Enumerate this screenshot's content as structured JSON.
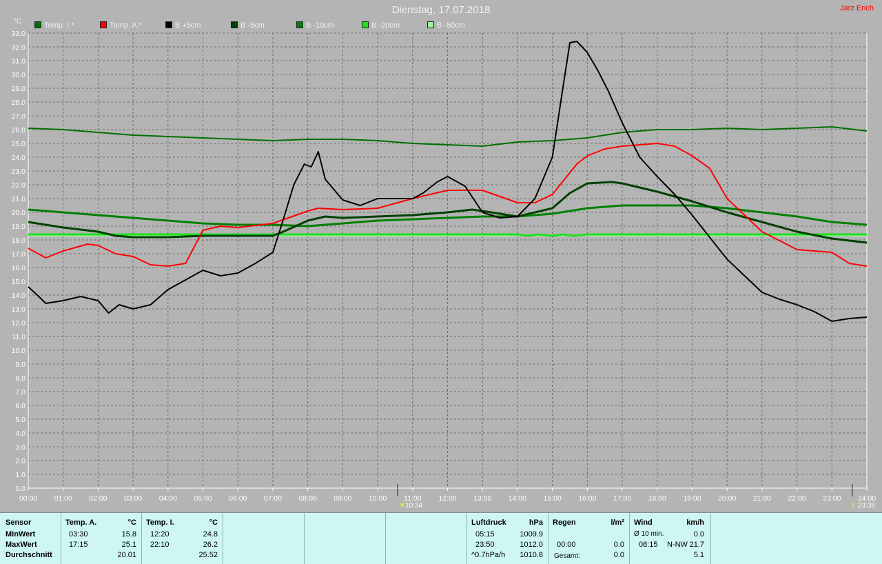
{
  "title": "Dienstag, 17.07.2018",
  "author": "Jarz Erich",
  "unit_label": "°C",
  "markers": {
    "left": {
      "time": "10:34",
      "hour": 10.567
    },
    "right": {
      "time": "23:35",
      "hour": 23.583
    }
  },
  "legend": [
    {
      "label": "Temp. I.*",
      "color": "#007000"
    },
    {
      "label": "Temp. A.*",
      "color": "#ff0000"
    },
    {
      "label": "B +5cm",
      "color": "#000000"
    },
    {
      "label": "B -5cm",
      "color": "#004000"
    },
    {
      "label": "B -10cm",
      "color": "#008000"
    },
    {
      "label": "B -20cm",
      "color": "#20e020"
    },
    {
      "label": "B -50cm",
      "color": "#a0f0a0"
    }
  ],
  "chart_data": {
    "type": "line",
    "title": "Dienstag, 17.07.2018",
    "ylabel": "°C",
    "ylim": [
      0,
      33
    ],
    "y_ticks": [
      "0.0",
      "1.0",
      "2.0",
      "3.0",
      "4.0",
      "5.0",
      "6.0",
      "7.0",
      "8.0",
      "9.0",
      "10.0",
      "11.0",
      "12.0",
      "13.0",
      "14.0",
      "15.0",
      "16.0",
      "17.0",
      "18.0",
      "19.0",
      "20.0",
      "21.0",
      "22.0",
      "23.0",
      "24.0",
      "25.0",
      "26.0",
      "27.0",
      "28.0",
      "29.0",
      "30.0",
      "31.0",
      "32.0",
      "33.0"
    ],
    "xlim": [
      0,
      24
    ],
    "x_ticks": [
      "00:00",
      "01:00",
      "02:00",
      "03:00",
      "04:00",
      "05:00",
      "06:00",
      "07:00",
      "08:00",
      "09:00",
      "10:00",
      "11:00",
      "12:00",
      "13:00",
      "14:00",
      "15:00",
      "16:00",
      "17:00",
      "18:00",
      "19:00",
      "20:00",
      "21:00",
      "22:00",
      "23:00",
      "24:00"
    ],
    "grid": true,
    "series": [
      {
        "name": "Temp. I.*",
        "color": "#007000",
        "width": 2,
        "x": [
          0,
          1,
          2,
          3,
          4,
          5,
          6,
          7,
          8,
          9,
          10,
          11,
          12,
          13,
          14,
          15,
          16,
          17,
          18,
          19,
          20,
          21,
          22,
          23,
          24
        ],
        "y": [
          26.1,
          26.0,
          25.8,
          25.6,
          25.5,
          25.4,
          25.3,
          25.2,
          25.3,
          25.3,
          25.2,
          25.0,
          24.9,
          24.8,
          25.1,
          25.2,
          25.4,
          25.8,
          26.0,
          26.0,
          26.1,
          26.0,
          26.1,
          26.2,
          25.9
        ]
      },
      {
        "name": "Temp. A.*",
        "color": "#ff0000",
        "width": 2,
        "x": [
          0,
          0.5,
          1,
          1.7,
          2,
          2.5,
          3,
          3.5,
          4,
          4.5,
          5,
          5.5,
          6,
          7,
          8,
          8.3,
          9,
          10,
          11,
          11.5,
          12,
          13,
          14,
          14.5,
          15,
          15.7,
          16,
          16.5,
          17,
          17.5,
          18,
          18.5,
          19,
          19.5,
          20,
          21,
          22,
          23,
          23.5,
          24
        ],
        "y": [
          17.4,
          16.7,
          17.2,
          17.7,
          17.6,
          17.0,
          16.8,
          16.2,
          16.1,
          16.3,
          18.7,
          19.0,
          18.9,
          19.2,
          20.1,
          20.3,
          20.2,
          20.3,
          21.0,
          21.3,
          21.6,
          21.6,
          20.7,
          20.7,
          21.3,
          23.5,
          24.1,
          24.6,
          24.8,
          24.9,
          25.0,
          24.8,
          24.1,
          23.2,
          21.0,
          18.6,
          17.3,
          17.1,
          16.3,
          16.1
        ]
      },
      {
        "name": "B +5cm",
        "color": "#000000",
        "width": 2,
        "x": [
          0,
          0.3,
          0.5,
          1,
          1.5,
          2,
          2.3,
          2.6,
          3,
          3.5,
          4,
          4.5,
          5,
          5.5,
          6,
          6.5,
          7,
          7.3,
          7.6,
          7.9,
          8.1,
          8.3,
          8.5,
          9,
          9.5,
          10,
          10.5,
          11,
          11.3,
          11.7,
          12,
          12.5,
          13,
          13.5,
          14,
          14.5,
          15,
          15.3,
          15.5,
          15.7,
          16,
          16.3,
          16.6,
          17,
          17.5,
          18,
          18.5,
          19,
          19.5,
          20,
          21,
          21.5,
          22,
          22.5,
          23,
          23.5,
          24
        ],
        "y": [
          14.6,
          13.9,
          13.4,
          13.6,
          13.9,
          13.6,
          12.7,
          13.3,
          13.0,
          13.3,
          14.4,
          15.1,
          15.8,
          15.4,
          15.6,
          16.3,
          17.1,
          19.5,
          22.0,
          23.5,
          23.3,
          24.4,
          22.4,
          20.9,
          20.5,
          21.0,
          21.0,
          21.0,
          21.4,
          22.2,
          22.6,
          21.9,
          20.0,
          19.6,
          19.7,
          21.0,
          24.0,
          29.0,
          32.3,
          32.4,
          31.6,
          30.3,
          28.8,
          26.5,
          24.0,
          22.6,
          21.3,
          19.8,
          18.2,
          16.6,
          14.2,
          13.7,
          13.3,
          12.8,
          12.1,
          12.3,
          12.4
        ]
      },
      {
        "name": "B -5cm",
        "color": "#004000",
        "width": 3,
        "x": [
          0,
          1,
          2,
          2.5,
          3,
          4,
          5,
          6,
          7,
          7.3,
          8,
          8.5,
          9,
          10,
          11,
          12,
          12.7,
          13,
          14,
          15,
          15.5,
          16,
          16.7,
          17,
          18,
          19,
          20,
          21,
          22,
          23,
          24
        ],
        "y": [
          19.3,
          18.9,
          18.6,
          18.3,
          18.2,
          18.2,
          18.3,
          18.3,
          18.3,
          18.6,
          19.4,
          19.7,
          19.6,
          19.7,
          19.8,
          20.0,
          20.2,
          20.1,
          19.7,
          20.3,
          21.4,
          22.1,
          22.2,
          22.1,
          21.5,
          20.8,
          20.0,
          19.3,
          18.6,
          18.1,
          17.8
        ]
      },
      {
        "name": "B -10cm",
        "color": "#008000",
        "width": 3,
        "x": [
          0,
          1,
          2,
          3,
          4,
          5,
          6,
          7,
          8,
          9,
          10,
          11,
          12,
          13,
          14,
          15,
          16,
          17,
          18,
          19,
          20,
          21,
          22,
          23,
          24
        ],
        "y": [
          20.2,
          20.0,
          19.8,
          19.6,
          19.4,
          19.2,
          19.1,
          19.1,
          19.0,
          19.2,
          19.4,
          19.5,
          19.6,
          19.7,
          19.7,
          19.9,
          20.3,
          20.5,
          20.5,
          20.5,
          20.3,
          20.0,
          19.7,
          19.3,
          19.1
        ]
      },
      {
        "name": "B -20cm",
        "color": "#20e020",
        "width": 3,
        "x": [
          0,
          4,
          8,
          12,
          14,
          14.3,
          14.6,
          15,
          15.3,
          15.6,
          16,
          20,
          24
        ],
        "y": [
          18.4,
          18.4,
          18.4,
          18.4,
          18.4,
          18.3,
          18.4,
          18.3,
          18.4,
          18.3,
          18.4,
          18.4,
          18.4
        ]
      },
      {
        "name": "B -50cm",
        "color": "#a0f0a0",
        "width": 2,
        "x": [
          0,
          24
        ],
        "y": [
          18.3,
          18.3
        ]
      }
    ]
  },
  "panel": {
    "sensor": {
      "header": "Sensor",
      "rows": [
        "MinWert",
        "MaxWert",
        "Durchschnitt"
      ]
    },
    "temp_a": {
      "header": "Temp. A.",
      "unit": "°C",
      "min_time": "03:30",
      "min_val": "15.8",
      "max_time": "17:15",
      "max_val": "25.1",
      "avg": "20.01"
    },
    "temp_i": {
      "header": "Temp. I.",
      "unit": "°C",
      "min_time": "12:20",
      "min_val": "24.8",
      "max_time": "22:10",
      "max_val": "26.2",
      "avg": "25.52"
    },
    "pressure": {
      "header": "Luftdruck",
      "unit": "hPa",
      "min_time": "05:15",
      "min_val": "1009.9",
      "max_time": "23:50",
      "max_val": "1012.0",
      "trend": "^0.7hPa/h",
      "avg": "1010.8"
    },
    "rain": {
      "header": "Regen",
      "unit": "l/m²",
      "time": "00:00",
      "val1": "0.0",
      "val2": "0.0",
      "total_label": "Gesamt:",
      "total": "0.0"
    },
    "wind": {
      "header": "Wind",
      "unit": "km/h",
      "avg_label": "Ø 10 min.",
      "avg_val": "0.0",
      "gust_time": "08:15",
      "gust_dir": "N-NW",
      "gust_val": "21.7",
      "day_avg": "5.1"
    }
  }
}
